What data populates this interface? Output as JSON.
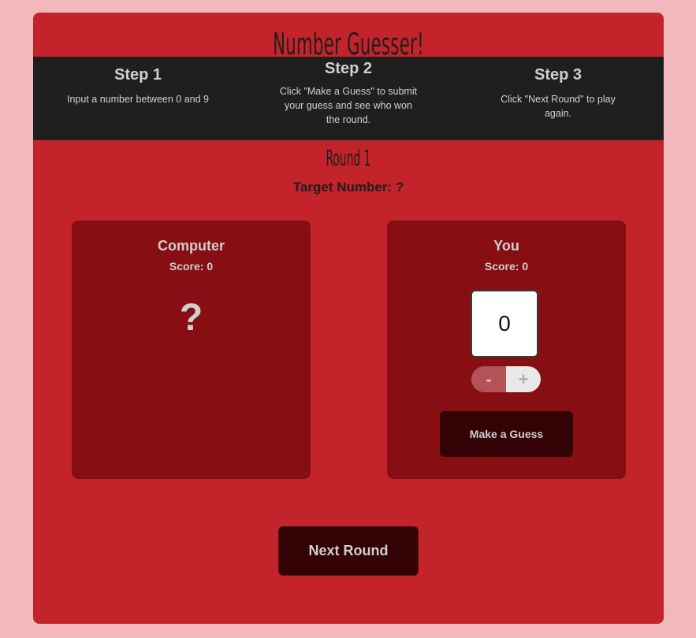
{
  "app": {
    "title": "Number Guesser!"
  },
  "steps": [
    {
      "heading": "Step 1",
      "text": "Input a number between 0 and 9"
    },
    {
      "heading": "Step 2",
      "text": "Click \"Make a Guess\" to submit your guess and see who won the round."
    },
    {
      "heading": "Step 3",
      "text": "Click \"Next Round\" to play again."
    }
  ],
  "round": {
    "label": "Round 1",
    "target": "Target Number: ?"
  },
  "computer": {
    "name": "Computer",
    "score": "Score: 0",
    "guess": "?"
  },
  "player": {
    "name": "You",
    "score": "Score: 0",
    "guess_value": "0",
    "decrement_label": "-",
    "increment_label": "+",
    "make_guess_label": "Make a Guess"
  },
  "controls": {
    "next_round_label": "Next Round"
  },
  "colors": {
    "page_bg": "#f2b8bc",
    "app_bg": "#c3232a",
    "steps_bg": "#1f1f1f",
    "panel_bg": "#870f13",
    "button_bg": "#330204"
  }
}
